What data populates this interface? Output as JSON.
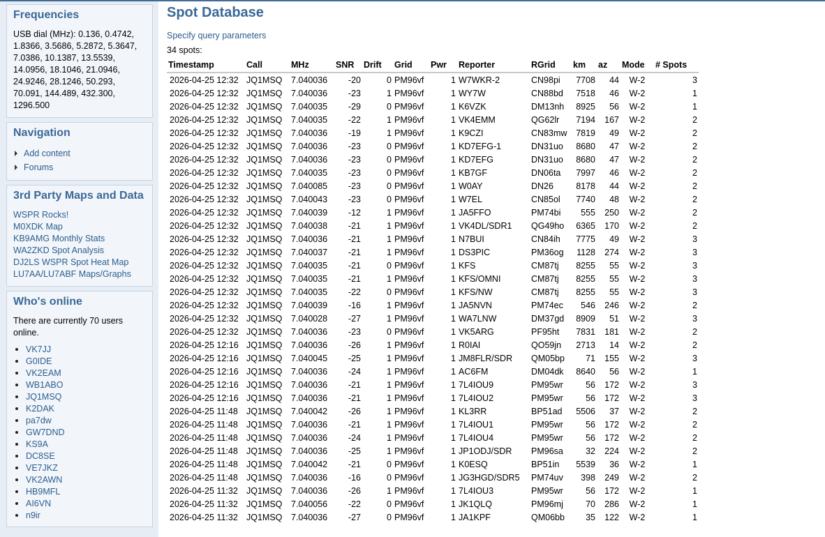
{
  "sidebar": {
    "frequencies": {
      "title": "Frequencies",
      "text": "USB dial (MHz): 0.136, 0.4742, 1.8366, 3.5686, 5.2872, 5.3647, 7.0386, 10.1387, 13.5539, 14.0956, 18.1046, 21.0946, 24.9246, 28.1246, 50.293, 70.091, 144.489, 432.300, 1296.500"
    },
    "navigation": {
      "title": "Navigation",
      "items": [
        "Add content",
        "Forums"
      ]
    },
    "third_party": {
      "title": "3rd Party Maps and Data",
      "links": [
        "WSPR Rocks!",
        "M0XDK Map",
        "KB9AMG Monthly Stats",
        "WA2ZKD Spot Analysis",
        "DJ2LS WSPR Spot Heat Map",
        "LU7AA/LU7ABF Maps/Graphs"
      ]
    },
    "whos_online": {
      "title": "Who's online",
      "text": "There are currently 70 users online.",
      "users": [
        "VK7JJ",
        "G0IDE",
        "VK2EAM",
        "WB1ABO",
        "JQ1MSQ",
        "K2DAK",
        "pa7dw",
        "GW7DND",
        "KS9A",
        "DC8SE",
        "VE7JKZ",
        "VK2AWN",
        "HB9MFL",
        "AI6VN",
        "n9ir"
      ]
    }
  },
  "main": {
    "title": "Spot Database",
    "query_link": "Specify query parameters",
    "spot_count": "34 spots:",
    "columns": [
      "Timestamp",
      "Call",
      "MHz",
      "SNR",
      "Drift",
      "Grid",
      "Pwr",
      "Reporter",
      "RGrid",
      "km",
      "az",
      "Mode",
      "# Spots"
    ],
    "rows": [
      [
        "2026-04-25 12:32",
        "JQ1MSQ",
        "7.040036",
        "-20",
        "0",
        "PM96vf",
        "1",
        "W7WKR-2",
        "CN98pi",
        "7708",
        "44",
        "W-2",
        "3"
      ],
      [
        "2026-04-25 12:32",
        "JQ1MSQ",
        "7.040036",
        "-23",
        "1",
        "PM96vf",
        "1",
        "WY7W",
        "CN88bd",
        "7518",
        "46",
        "W-2",
        "1"
      ],
      [
        "2026-04-25 12:32",
        "JQ1MSQ",
        "7.040035",
        "-29",
        "0",
        "PM96vf",
        "1",
        "K6VZK",
        "DM13nh",
        "8925",
        "56",
        "W-2",
        "1"
      ],
      [
        "2026-04-25 12:32",
        "JQ1MSQ",
        "7.040035",
        "-22",
        "1",
        "PM96vf",
        "1",
        "VK4EMM",
        "QG62lr",
        "7194",
        "167",
        "W-2",
        "2"
      ],
      [
        "2026-04-25 12:32",
        "JQ1MSQ",
        "7.040036",
        "-19",
        "1",
        "PM96vf",
        "1",
        "K9CZI",
        "CN83mw",
        "7819",
        "49",
        "W-2",
        "2"
      ],
      [
        "2026-04-25 12:32",
        "JQ1MSQ",
        "7.040036",
        "-23",
        "0",
        "PM96vf",
        "1",
        "KD7EFG-1",
        "DN31uo",
        "8680",
        "47",
        "W-2",
        "2"
      ],
      [
        "2026-04-25 12:32",
        "JQ1MSQ",
        "7.040036",
        "-23",
        "0",
        "PM96vf",
        "1",
        "KD7EFG",
        "DN31uo",
        "8680",
        "47",
        "W-2",
        "2"
      ],
      [
        "2026-04-25 12:32",
        "JQ1MSQ",
        "7.040035",
        "-23",
        "0",
        "PM96vf",
        "1",
        "KB7GF",
        "DN06ta",
        "7997",
        "46",
        "W-2",
        "2"
      ],
      [
        "2026-04-25 12:32",
        "JQ1MSQ",
        "7.040085",
        "-23",
        "0",
        "PM96vf",
        "1",
        "W0AY",
        "DN26",
        "8178",
        "44",
        "W-2",
        "2"
      ],
      [
        "2026-04-25 12:32",
        "JQ1MSQ",
        "7.040043",
        "-23",
        "0",
        "PM96vf",
        "1",
        "W7EL",
        "CN85ol",
        "7740",
        "48",
        "W-2",
        "2"
      ],
      [
        "2026-04-25 12:32",
        "JQ1MSQ",
        "7.040039",
        "-12",
        "1",
        "PM96vf",
        "1",
        "JA5FFO",
        "PM74bi",
        "555",
        "250",
        "W-2",
        "2"
      ],
      [
        "2026-04-25 12:32",
        "JQ1MSQ",
        "7.040038",
        "-21",
        "1",
        "PM96vf",
        "1",
        "VK4DL/SDR1",
        "QG49ho",
        "6365",
        "170",
        "W-2",
        "2"
      ],
      [
        "2026-04-25 12:32",
        "JQ1MSQ",
        "7.040036",
        "-21",
        "1",
        "PM96vf",
        "1",
        "N7BUI",
        "CN84ih",
        "7775",
        "49",
        "W-2",
        "3"
      ],
      [
        "2026-04-25 12:32",
        "JQ1MSQ",
        "7.040037",
        "-21",
        "1",
        "PM96vf",
        "1",
        "DS3PIC",
        "PM36og",
        "1128",
        "274",
        "W-2",
        "3"
      ],
      [
        "2026-04-25 12:32",
        "JQ1MSQ",
        "7.040035",
        "-21",
        "0",
        "PM96vf",
        "1",
        "KFS",
        "CM87tj",
        "8255",
        "55",
        "W-2",
        "3"
      ],
      [
        "2026-04-25 12:32",
        "JQ1MSQ",
        "7.040035",
        "-21",
        "1",
        "PM96vf",
        "1",
        "KFS/OMNI",
        "CM87tj",
        "8255",
        "55",
        "W-2",
        "3"
      ],
      [
        "2026-04-25 12:32",
        "JQ1MSQ",
        "7.040035",
        "-22",
        "0",
        "PM96vf",
        "1",
        "KFS/NW",
        "CM87tj",
        "8255",
        "55",
        "W-2",
        "3"
      ],
      [
        "2026-04-25 12:32",
        "JQ1MSQ",
        "7.040039",
        "-16",
        "1",
        "PM96vf",
        "1",
        "JA5NVN",
        "PM74ec",
        "546",
        "246",
        "W-2",
        "2"
      ],
      [
        "2026-04-25 12:32",
        "JQ1MSQ",
        "7.040028",
        "-27",
        "1",
        "PM96vf",
        "1",
        "WA7LNW",
        "DM37gd",
        "8909",
        "51",
        "W-2",
        "3"
      ],
      [
        "2026-04-25 12:32",
        "JQ1MSQ",
        "7.040036",
        "-23",
        "0",
        "PM96vf",
        "1",
        "VK5ARG",
        "PF95ht",
        "7831",
        "181",
        "W-2",
        "2"
      ],
      [
        "2026-04-25 12:16",
        "JQ1MSQ",
        "7.040036",
        "-26",
        "1",
        "PM96vf",
        "1",
        "R0IAI",
        "QO59jn",
        "2713",
        "14",
        "W-2",
        "2"
      ],
      [
        "2026-04-25 12:16",
        "JQ1MSQ",
        "7.040045",
        "-25",
        "1",
        "PM96vf",
        "1",
        "JM8FLR/SDR",
        "QM05bp",
        "71",
        "155",
        "W-2",
        "3"
      ],
      [
        "2026-04-25 12:16",
        "JQ1MSQ",
        "7.040036",
        "-24",
        "1",
        "PM96vf",
        "1",
        "AC6FM",
        "DM04dk",
        "8640",
        "56",
        "W-2",
        "1"
      ],
      [
        "2026-04-25 12:16",
        "JQ1MSQ",
        "7.040036",
        "-21",
        "1",
        "PM96vf",
        "1",
        "7L4IOU9",
        "PM95wr",
        "56",
        "172",
        "W-2",
        "3"
      ],
      [
        "2026-04-25 12:16",
        "JQ1MSQ",
        "7.040036",
        "-21",
        "1",
        "PM96vf",
        "1",
        "7L4IOU2",
        "PM95wr",
        "56",
        "172",
        "W-2",
        "3"
      ],
      [
        "2026-04-25 11:48",
        "JQ1MSQ",
        "7.040042",
        "-26",
        "1",
        "PM96vf",
        "1",
        "KL3RR",
        "BP51ad",
        "5506",
        "37",
        "W-2",
        "2"
      ],
      [
        "2026-04-25 11:48",
        "JQ1MSQ",
        "7.040036",
        "-21",
        "1",
        "PM96vf",
        "1",
        "7L4IOU1",
        "PM95wr",
        "56",
        "172",
        "W-2",
        "2"
      ],
      [
        "2026-04-25 11:48",
        "JQ1MSQ",
        "7.040036",
        "-24",
        "1",
        "PM96vf",
        "1",
        "7L4IOU4",
        "PM95wr",
        "56",
        "172",
        "W-2",
        "2"
      ],
      [
        "2026-04-25 11:48",
        "JQ1MSQ",
        "7.040036",
        "-25",
        "1",
        "PM96vf",
        "1",
        "JP1ODJ/SDR",
        "PM96sa",
        "32",
        "224",
        "W-2",
        "2"
      ],
      [
        "2026-04-25 11:48",
        "JQ1MSQ",
        "7.040042",
        "-21",
        "0",
        "PM96vf",
        "1",
        "K0ESQ",
        "BP51in",
        "5539",
        "36",
        "W-2",
        "1"
      ],
      [
        "2026-04-25 11:48",
        "JQ1MSQ",
        "7.040036",
        "-16",
        "0",
        "PM96vf",
        "1",
        "JG3HGD/SDR5",
        "PM74uv",
        "398",
        "249",
        "W-2",
        "2"
      ],
      [
        "2026-04-25 11:32",
        "JQ1MSQ",
        "7.040036",
        "-26",
        "1",
        "PM96vf",
        "1",
        "7L4IOU3",
        "PM95wr",
        "56",
        "172",
        "W-2",
        "1"
      ],
      [
        "2026-04-25 11:32",
        "JQ1MSQ",
        "7.040056",
        "-22",
        "0",
        "PM96vf",
        "1",
        "JK1QLQ",
        "PM96mj",
        "70",
        "286",
        "W-2",
        "1"
      ],
      [
        "2026-04-25 11:32",
        "JQ1MSQ",
        "7.040036",
        "-27",
        "0",
        "PM96vf",
        "1",
        "JA1KPF",
        "QM06bb",
        "35",
        "122",
        "W-2",
        "1"
      ]
    ]
  }
}
